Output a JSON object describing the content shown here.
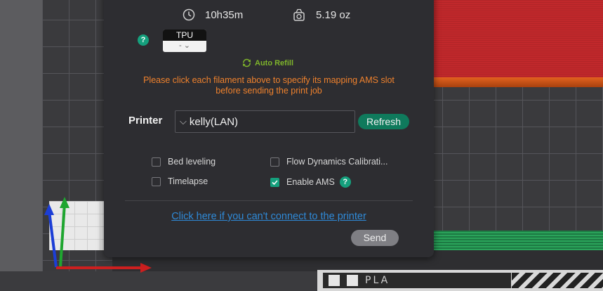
{
  "stats": {
    "time": "10h35m",
    "weight": "5.19 oz",
    "time_icon": "clock-icon",
    "weight_icon": "scale-icon"
  },
  "filament": {
    "type": "TPU",
    "slot": "-",
    "help_icon": "help-icon"
  },
  "auto_refill": {
    "label": "Auto Refill",
    "icon": "auto-refill-icon"
  },
  "warning": {
    "line1": "Please click each filament above to specify its mapping AMS slot",
    "line2": "before sending the print job"
  },
  "printer": {
    "label": "Printer",
    "selected": "kelly(LAN)",
    "refresh_label": "Refresh"
  },
  "options": {
    "bed_leveling": {
      "label": "Bed leveling",
      "checked": false
    },
    "flow_dynamics": {
      "label": "Flow Dynamics Calibrati...",
      "checked": false
    },
    "timelapse": {
      "label": "Timelapse",
      "checked": false
    },
    "enable_ams": {
      "label": "Enable AMS",
      "checked": true
    }
  },
  "link_text": "Click here if you can't connect to the printer",
  "send_label": "Send",
  "plate": {
    "filament_label": "PLA"
  },
  "colors": {
    "accent": "#15a07d",
    "warning": "#f0822d",
    "link": "#2f8ad8",
    "auto_refill": "#7fb52b",
    "dialog_bg": "#2d2d31"
  }
}
